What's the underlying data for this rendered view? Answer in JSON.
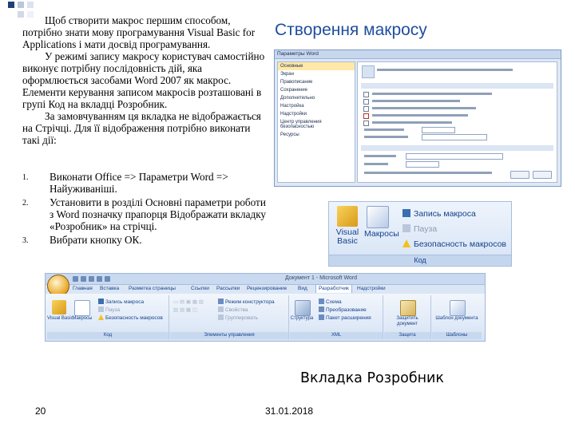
{
  "title": "Створення макросу",
  "intro": [
    "Щоб створити макрос першим способом, потрібно знати мову програмування Visual Basic for Applications і мати досвід програмування.",
    "У режимі запису макросу користувач самостійно виконує потрібну послідовність дій, яка оформлюється засобами Word 2007 як макрос. Елементи керування записом макросів розташовані в групі Код на вкладці Розробник.",
    "За замовчуванням ця вкладка не відображається на Стрічці. Для її відображення потрібно виконати такі дії:"
  ],
  "steps": [
    {
      "num": "1.",
      "text": "Виконати Office => Параметри Word => Найуживаніші."
    },
    {
      "num": "2.",
      "text": "Установити в розділі Основні параметри роботи з Word позначку прапорця Відображати вкладку «Розробник» на стрічці."
    },
    {
      "num": "3.",
      "text": "Вибрати кнопку ОК."
    }
  ],
  "options_dialog": {
    "title": "Параметры Word",
    "nav": [
      "Основные",
      "Экран",
      "Правописание",
      "Сохранение",
      "Дополнительно",
      "Настройка",
      "Надстройки",
      "Центр управления безопасностью",
      "Ресурсы"
    ]
  },
  "code_group": {
    "visual_basic": "Visual Basic",
    "macros": "Макросы",
    "record": "Запись макроса",
    "pause": "Пауза",
    "security": "Безопасность макросов",
    "label": "Код"
  },
  "ribbon": {
    "window_title": "Документ 1 - Microsoft Word",
    "tabs": [
      "Главная",
      "Вставка",
      "Разметка страницы",
      "Ссылки",
      "Рассылки",
      "Рецензирование",
      "Вид",
      "Разработчик",
      "Надстройки"
    ],
    "groups": [
      {
        "label": "Код"
      },
      {
        "label": "Элементы управления"
      },
      {
        "label": "XML"
      },
      {
        "label": "Защита"
      },
      {
        "label": "Шаблоны"
      }
    ],
    "code_vb": "Visual Basic",
    "code_macros": "Макросы",
    "code_record": "Запись макроса",
    "code_pause": "Пауза",
    "code_security": "Безопасность макросов",
    "ctrl_mode": "Режим конструктора",
    "ctrl_props": "Свойства",
    "ctrl_group": "Группировать",
    "xml_struct": "Структура",
    "xml_schema": "Схема",
    "xml_transform": "Преобразование",
    "xml_pack": "Пакет расширения",
    "protect": "Защитить документ",
    "templates": "Шаблон документа"
  },
  "caption": "Вкладка Розробник",
  "page_number": "20",
  "date": "31.01.2018"
}
